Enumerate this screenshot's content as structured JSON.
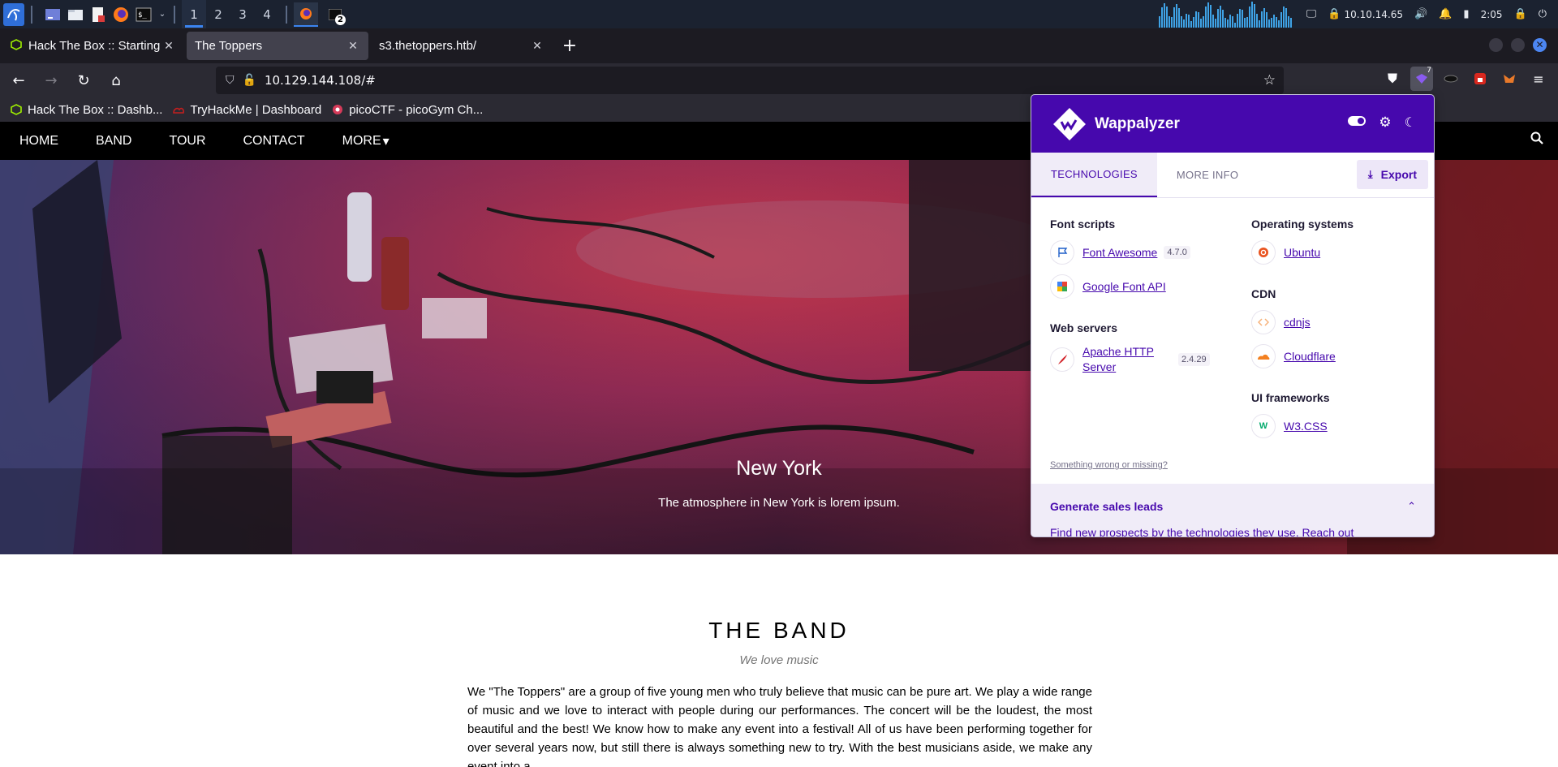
{
  "taskbar": {
    "workspaces": [
      "1",
      "2",
      "3",
      "4"
    ],
    "active_workspace": "1",
    "window_badge": "2",
    "ip_address": "10.10.14.65",
    "clock": "2:05"
  },
  "browser": {
    "tabs": [
      {
        "title": "Hack The Box :: Starting Point",
        "active": false,
        "icon": "htb-cube-icon"
      },
      {
        "title": "The Toppers",
        "active": true,
        "icon": "none"
      },
      {
        "title": "s3.thetoppers.htb/",
        "active": false,
        "icon": "none"
      }
    ],
    "url": "10.129.144.108/#",
    "extension_badge": "7",
    "bookmarks": [
      {
        "label": "Hack The Box :: Dashb...",
        "icon": "htb-cube-icon"
      },
      {
        "label": "TryHackMe | Dashboard",
        "icon": "tryhackme-icon"
      },
      {
        "label": "picoCTF - picoGym Ch...",
        "icon": "picoctf-icon"
      }
    ]
  },
  "site": {
    "nav": [
      "HOME",
      "BAND",
      "TOUR",
      "CONTACT",
      "MORE"
    ],
    "more_caret": "▾",
    "hero": {
      "title": "New York",
      "subtitle": "The atmosphere in New York is lorem ipsum."
    },
    "band": {
      "title": "THE BAND",
      "subtitle": "We love music",
      "text": "We \"The Toppers\" are a group of five young men who truly believe that music can be pure art. We play a wide range of music and we love to interact with people during our performances. The concert will be the loudest, the most beautiful and the best! We know how to make any event into a festival! All of us have been performing together for over several years now, but still there is always something new to try. With the best musicians aside, we make any event into a"
    }
  },
  "wappalyzer": {
    "name": "Wappalyzer",
    "tabs": [
      "TECHNOLOGIES",
      "MORE INFO"
    ],
    "active_tab": "TECHNOLOGIES",
    "export_label": "Export",
    "left_column": [
      {
        "category": "Font scripts",
        "items": [
          {
            "name": "Font Awesome",
            "version": "4.7.0",
            "icon": "flag-icon"
          },
          {
            "name": "Google Font API",
            "version": "",
            "icon": "google-fonts-icon"
          }
        ]
      },
      {
        "category": "Web servers",
        "items": [
          {
            "name": "Apache HTTP Server",
            "version": "2.4.29",
            "icon": "apache-feather-icon"
          }
        ]
      }
    ],
    "right_column": [
      {
        "category": "Operating systems",
        "items": [
          {
            "name": "Ubuntu",
            "version": "",
            "icon": "ubuntu-icon"
          }
        ]
      },
      {
        "category": "CDN",
        "items": [
          {
            "name": "cdnjs",
            "version": "",
            "icon": "cdnjs-icon"
          },
          {
            "name": "Cloudflare",
            "version": "",
            "icon": "cloudflare-icon"
          }
        ]
      },
      {
        "category": "UI frameworks",
        "items": [
          {
            "name": "W3.CSS",
            "version": "",
            "icon": "w3css-icon"
          }
        ]
      }
    ],
    "missing_link": "Something wrong or missing?",
    "leads_title": "Generate sales leads",
    "leads_text": "Find new prospects by the technologies they use. Reach out"
  },
  "colors": {
    "wappalyzer_purple": "#4608ad",
    "taskbar_bg": "#1b2230",
    "browser_bg": "#2b2a33",
    "site_nav_bg": "#000000"
  }
}
